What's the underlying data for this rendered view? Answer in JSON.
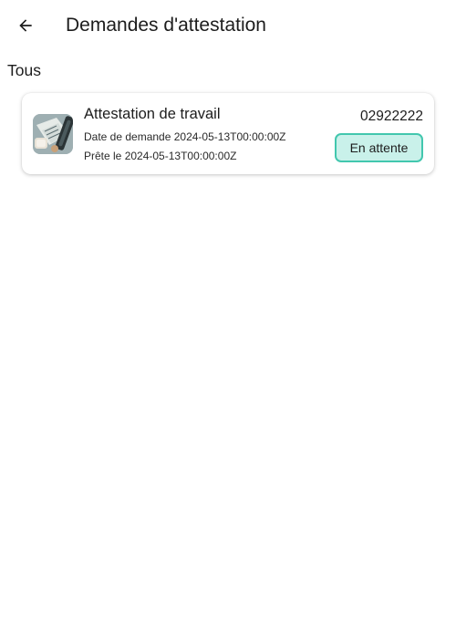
{
  "app_bar": {
    "back_icon": "arrow-left-icon",
    "title": "Demandes d'attestation"
  },
  "section": {
    "label": "Tous"
  },
  "requests": [
    {
      "thumbnail_icon": "document-photo-icon",
      "title": "Attestation de travail",
      "request_date": "Date de demande 2024-05-13T00:00:00Z",
      "ready_date": "Prête le 2024-05-13T00:00:00Z",
      "number": "02922222",
      "status": "En attente",
      "status_colors": {
        "background": "#c9f1ea",
        "border": "#42c7ae"
      }
    }
  ]
}
